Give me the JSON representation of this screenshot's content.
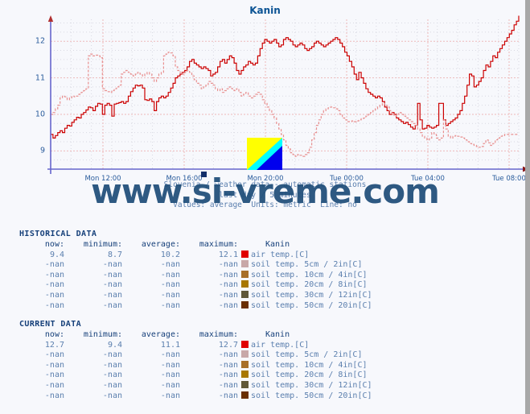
{
  "site_label": "www.si-vreme.com",
  "watermark": "www.si-vreme.com",
  "chart": {
    "title": "Kanin",
    "subtitle_line1": "Slovenia / weather data - automatic stations",
    "subtitle_line2": "last day / 5 minutes",
    "subtitle_line3": "Values: average  Units: metric  Line: no"
  },
  "colors": {
    "title": "#0b5394",
    "axis": "#6666cc",
    "grid": "#f0c0c0",
    "current_line": "#cc0000",
    "historical_line": "#e88f8f",
    "text": "#5b7fae",
    "header_text": "#16407a",
    "air_temp": "#e00000",
    "soil_5cm": "#c8a8a8",
    "soil_10cm": "#a87028",
    "soil_20cm": "#a87800",
    "soil_30cm": "#605838",
    "soil_50cm": "#6b3000",
    "logo_yellow": "#ffff00",
    "logo_cyan": "#00ffff",
    "logo_blue": "#0000ee"
  },
  "chart_data": {
    "type": "line",
    "title": "Kanin",
    "xlabel": "",
    "ylabel": "air temp. [C]",
    "ylim": [
      8.5,
      12.6
    ],
    "yticks": [
      9,
      10,
      11,
      12
    ],
    "ytick_labels": [
      "9",
      "10",
      "11",
      "12"
    ],
    "xticks": [
      "Mon 12:00",
      "Mon 16:00",
      "Mon 20:00",
      "Tue 00:00",
      "Tue 04:00",
      "Tue 08:00"
    ],
    "grid": true,
    "legend": false,
    "series": [
      {
        "name": "current air temp. [C]",
        "color": "#cc0000",
        "style": "solid",
        "values": [
          9.45,
          9.35,
          9.42,
          9.5,
          9.55,
          9.5,
          9.62,
          9.7,
          9.68,
          9.78,
          9.85,
          9.92,
          9.9,
          10.0,
          10.05,
          10.12,
          10.2,
          10.18,
          10.1,
          10.22,
          10.3,
          10.28,
          10.0,
          10.25,
          10.3,
          10.25,
          9.95,
          10.28,
          10.3,
          10.32,
          10.35,
          10.3,
          10.35,
          10.5,
          10.62,
          10.72,
          10.8,
          10.78,
          10.8,
          10.72,
          10.4,
          10.38,
          10.42,
          10.35,
          10.1,
          10.35,
          10.45,
          10.5,
          10.45,
          10.5,
          10.6,
          10.72,
          10.85,
          11.0,
          11.05,
          11.1,
          11.15,
          11.2,
          11.3,
          11.45,
          11.5,
          11.4,
          11.35,
          11.3,
          11.25,
          11.3,
          11.25,
          11.2,
          11.05,
          11.1,
          11.15,
          11.3,
          11.45,
          11.5,
          11.4,
          11.5,
          11.6,
          11.55,
          11.4,
          11.2,
          11.1,
          11.2,
          11.3,
          11.35,
          11.45,
          11.4,
          11.35,
          11.4,
          11.6,
          11.8,
          11.95,
          12.05,
          12.0,
          11.95,
          12.0,
          12.05,
          11.95,
          11.85,
          11.9,
          12.05,
          12.1,
          12.05,
          12.0,
          11.9,
          11.85,
          11.9,
          11.95,
          11.9,
          11.8,
          11.75,
          11.8,
          11.85,
          11.95,
          12.0,
          11.95,
          11.9,
          11.85,
          11.9,
          11.95,
          12.0,
          12.05,
          12.1,
          12.05,
          11.95,
          11.85,
          11.7,
          11.6,
          11.45,
          11.3,
          11.1,
          10.95,
          11.15,
          11.0,
          10.85,
          10.7,
          10.6,
          10.55,
          10.5,
          10.45,
          10.5,
          10.45,
          10.35,
          10.2,
          10.1,
          10.0,
          10.05,
          10.0,
          9.9,
          9.85,
          9.8,
          9.75,
          9.78,
          9.72,
          9.65,
          9.6,
          9.7,
          10.3,
          9.85,
          9.6,
          9.62,
          9.7,
          9.65,
          9.62,
          9.65,
          9.7,
          10.3,
          10.3,
          9.85,
          9.7,
          9.75,
          9.8,
          9.85,
          9.9,
          10.0,
          10.1,
          10.3,
          10.5,
          10.8,
          11.1,
          11.05,
          10.75,
          10.8,
          10.9,
          11.0,
          11.2,
          11.35,
          11.3,
          11.45,
          11.6,
          11.55,
          11.7,
          11.8,
          11.9,
          12.0,
          12.1,
          12.2,
          12.3,
          12.45,
          12.55,
          12.7
        ]
      },
      {
        "name": "historical air temp. [C]",
        "color": "#e88f8f",
        "style": "dashed",
        "values": [
          10.0,
          10.05,
          10.15,
          10.25,
          10.45,
          10.5,
          10.48,
          10.4,
          10.45,
          10.5,
          10.48,
          10.5,
          10.55,
          10.6,
          10.65,
          10.7,
          11.6,
          11.65,
          11.6,
          11.62,
          11.6,
          11.55,
          10.7,
          10.65,
          10.62,
          10.6,
          10.65,
          10.7,
          10.75,
          10.8,
          11.1,
          11.15,
          11.2,
          11.15,
          11.1,
          11.05,
          11.1,
          11.15,
          11.1,
          11.05,
          11.1,
          11.15,
          11.1,
          11.0,
          10.9,
          11.0,
          11.1,
          11.15,
          11.6,
          11.65,
          11.7,
          11.68,
          11.6,
          11.3,
          11.2,
          11.15,
          11.1,
          11.15,
          11.2,
          11.15,
          11.05,
          10.95,
          10.85,
          10.8,
          10.7,
          10.75,
          10.8,
          10.9,
          10.85,
          10.8,
          10.7,
          10.65,
          10.7,
          10.6,
          10.65,
          10.7,
          10.75,
          10.7,
          10.65,
          10.7,
          10.6,
          10.5,
          10.55,
          10.6,
          10.5,
          10.45,
          10.5,
          10.55,
          10.6,
          10.55,
          10.4,
          10.3,
          10.2,
          10.1,
          10.0,
          9.9,
          9.75,
          9.6,
          9.45,
          9.3,
          9.15,
          9.05,
          8.95,
          8.9,
          8.85,
          8.9,
          8.88,
          8.85,
          8.9,
          8.95,
          9.1,
          9.3,
          9.5,
          9.7,
          9.85,
          10.0,
          10.1,
          10.15,
          10.18,
          10.2,
          10.18,
          10.15,
          10.1,
          10.0,
          9.9,
          9.85,
          9.8,
          9.8,
          9.82,
          9.8,
          9.82,
          9.85,
          9.88,
          9.9,
          9.95,
          10.0,
          10.05,
          10.1,
          10.15,
          10.2,
          10.25,
          10.3,
          10.25,
          10.2,
          10.1,
          10.0,
          9.95,
          10.0,
          10.05,
          10.0,
          9.95,
          9.9,
          9.85,
          9.8,
          9.75,
          9.7,
          9.6,
          9.5,
          9.4,
          9.35,
          9.3,
          9.35,
          9.5,
          9.45,
          9.35,
          9.3,
          9.35,
          9.85,
          9.6,
          9.4,
          9.35,
          9.4,
          9.42,
          9.4,
          9.38,
          9.35,
          9.3,
          9.25,
          9.2,
          9.18,
          9.15,
          9.12,
          9.1,
          9.12,
          9.2,
          9.3,
          9.22,
          9.15,
          9.2,
          9.3,
          9.35,
          9.4,
          9.42,
          9.45,
          9.45,
          9.45,
          9.45,
          9.45,
          9.45,
          9.45
        ]
      }
    ]
  },
  "historical": {
    "section_title": "HISTORICAL DATA",
    "headers": [
      "now:",
      "minimum:",
      "average:",
      "maximum:",
      "Kanin"
    ],
    "rows": [
      {
        "now": "9.4",
        "minimum": "8.7",
        "average": "10.2",
        "maximum": "12.1",
        "color": "#e00000",
        "label": "air temp.[C]"
      },
      {
        "now": "-nan",
        "minimum": "-nan",
        "average": "-nan",
        "maximum": "-nan",
        "color": "#c8a8a8",
        "label": "soil temp. 5cm / 2in[C]"
      },
      {
        "now": "-nan",
        "minimum": "-nan",
        "average": "-nan",
        "maximum": "-nan",
        "color": "#a87028",
        "label": "soil temp. 10cm / 4in[C]"
      },
      {
        "now": "-nan",
        "minimum": "-nan",
        "average": "-nan",
        "maximum": "-nan",
        "color": "#a87800",
        "label": "soil temp. 20cm / 8in[C]"
      },
      {
        "now": "-nan",
        "minimum": "-nan",
        "average": "-nan",
        "maximum": "-nan",
        "color": "#605838",
        "label": "soil temp. 30cm / 12in[C]"
      },
      {
        "now": "-nan",
        "minimum": "-nan",
        "average": "-nan",
        "maximum": "-nan",
        "color": "#6b3000",
        "label": "soil temp. 50cm / 20in[C]"
      }
    ]
  },
  "current": {
    "section_title": "CURRENT DATA",
    "headers": [
      "now:",
      "minimum:",
      "average:",
      "maximum:",
      "Kanin"
    ],
    "rows": [
      {
        "now": "12.7",
        "minimum": "9.4",
        "average": "11.1",
        "maximum": "12.7",
        "color": "#e00000",
        "label": "air temp.[C]"
      },
      {
        "now": "-nan",
        "minimum": "-nan",
        "average": "-nan",
        "maximum": "-nan",
        "color": "#c8a8a8",
        "label": "soil temp. 5cm / 2in[C]"
      },
      {
        "now": "-nan",
        "minimum": "-nan",
        "average": "-nan",
        "maximum": "-nan",
        "color": "#a87028",
        "label": "soil temp. 10cm / 4in[C]"
      },
      {
        "now": "-nan",
        "minimum": "-nan",
        "average": "-nan",
        "maximum": "-nan",
        "color": "#a87800",
        "label": "soil temp. 20cm / 8in[C]"
      },
      {
        "now": "-nan",
        "minimum": "-nan",
        "average": "-nan",
        "maximum": "-nan",
        "color": "#605838",
        "label": "soil temp. 30cm / 12in[C]"
      },
      {
        "now": "-nan",
        "minimum": "-nan",
        "average": "-nan",
        "maximum": "-nan",
        "color": "#6b3000",
        "label": "soil temp. 50cm / 20in[C]"
      }
    ]
  }
}
